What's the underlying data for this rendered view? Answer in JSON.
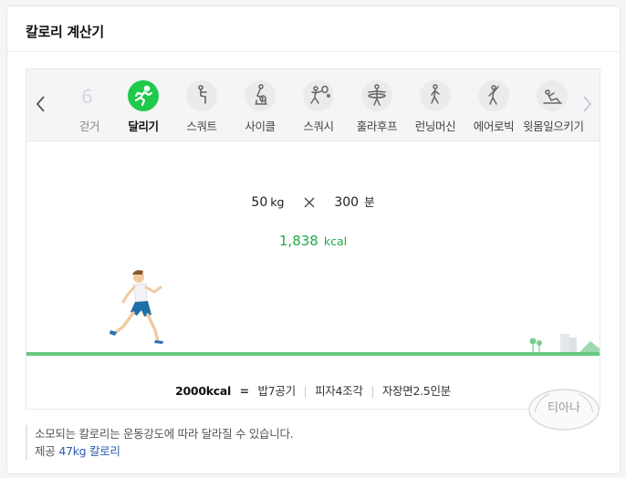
{
  "card": {
    "title": "칼로리 계산기"
  },
  "exercises": [
    {
      "label": "걷거",
      "icon": "walk-partial-icon",
      "active": false
    },
    {
      "label": "달리기",
      "icon": "running-icon",
      "active": true
    },
    {
      "label": "스쿼트",
      "icon": "squat-icon",
      "active": false
    },
    {
      "label": "사이클",
      "icon": "cycling-icon",
      "active": false
    },
    {
      "label": "스쿼시",
      "icon": "squash-icon",
      "active": false
    },
    {
      "label": "훌라후프",
      "icon": "hula-hoop-icon",
      "active": false
    },
    {
      "label": "런닝머신",
      "icon": "treadmill-icon",
      "active": false
    },
    {
      "label": "에어로빅",
      "icon": "aerobics-icon",
      "active": false
    },
    {
      "label": "윗몸일으키기",
      "icon": "sit-up-icon",
      "active": false
    }
  ],
  "calc": {
    "weight": "50",
    "weight_unit": "kg",
    "duration": "300",
    "duration_unit": "분",
    "kcal": "1,838",
    "kcal_unit": "kcal"
  },
  "equivalents": {
    "base": "2000kcal",
    "equals": "=",
    "items": [
      "밥7공기",
      "피자4조각",
      "자장면2.5인분"
    ],
    "separator": "|"
  },
  "notes": {
    "line1": "소모되는 칼로리는 운동강도에 따라 달라질 수 있습니다.",
    "source_prefix": "제공",
    "source_link": "47kg 칼로리"
  },
  "watermark": {
    "text": "티아나"
  },
  "colors": {
    "accent_green": "#1ec94b",
    "kcal_green": "#1fab4b",
    "ground_green": "#67c97e",
    "link_blue": "#2a5db0"
  }
}
